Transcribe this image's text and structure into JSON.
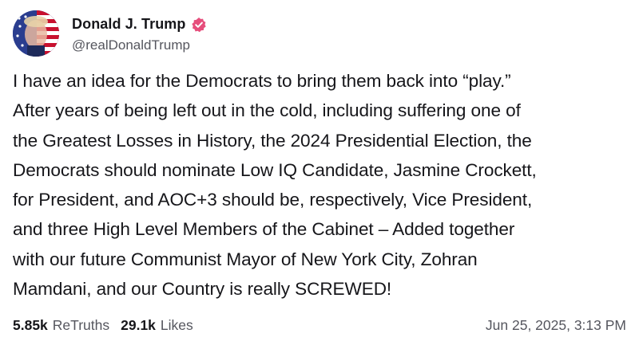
{
  "author": {
    "display_name": "Donald J. Trump",
    "handle": "@realDonaldTrump",
    "verified_icon": "verified-badge-icon",
    "verified_color": "#e64e7c"
  },
  "post": {
    "text": "I have an idea for the Democrats to bring them back into “play.”\nAfter years of being left out in the cold, including suffering one of\nthe Greatest Losses in History, the 2024 Presidential Election, the\nDemocrats should nominate Low IQ Candidate, Jasmine Crockett,\nfor President, and AOC+3 should be, respectively, Vice President,\nand three High Level Members of the Cabinet – Added together\nwith our future Communist Mayor of New York City, Zohran\nMamdani, and our Country is really SCREWED!"
  },
  "stats": {
    "retruths_count": "5.85k",
    "retruths_label": "ReTruths",
    "likes_count": "29.1k",
    "likes_label": "Likes"
  },
  "timestamp": "Jun 25, 2025, 3:13 PM"
}
